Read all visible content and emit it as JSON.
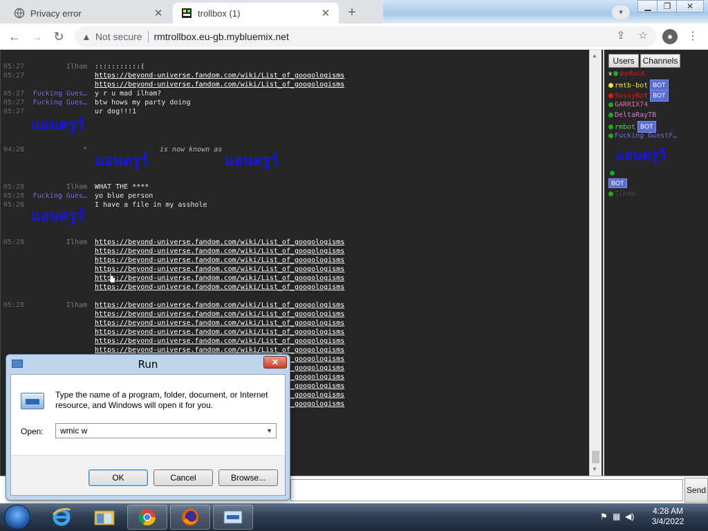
{
  "browser": {
    "tabs": [
      {
        "title": "Privacy error",
        "icon": "globe-icon"
      },
      {
        "title": "trollbox (1)",
        "icon": "trollbox-favicon"
      }
    ],
    "new_tab": "+",
    "close_glyph": "✕",
    "address": {
      "warning": "Not secure",
      "url": "rmtrollbox.eu-gb.mybluemix.net"
    }
  },
  "chat": {
    "lines": [
      {
        "time": "05:27",
        "nick": "Ilham",
        "text": ":::::::::::(",
        "link": false,
        "guest": false
      },
      {
        "time": "05:27",
        "nick": "",
        "text": "https://beyond-universe.fandom.com/wiki/List_of_googologisms",
        "link": true,
        "guest": false
      },
      {
        "time": "",
        "nick": "",
        "text": "https://beyond-universe.fandom.com/wiki/List_of_googologisms",
        "link": true,
        "guest": false
      },
      {
        "time": "05:27",
        "nick": "Fucking Gues…",
        "text": "y r u mad ilham?",
        "link": false,
        "guest": true
      },
      {
        "time": "05:27",
        "nick": "Fucking Gues…",
        "text": "btw hows my party doing",
        "link": false,
        "guest": true
      },
      {
        "time": "05:27",
        "nick": "",
        "text": "ur dog!!!1",
        "link": false,
        "guest": false
      }
    ],
    "rename_line": {
      "time": "04:28",
      "nick": "*",
      "text": "is now known as"
    },
    "thai_name": "แอนดรูว์",
    "lines2": [
      {
        "time": "05:28",
        "nick": "Ilham",
        "text": "WHAT THE ****",
        "guest": false
      },
      {
        "time": "05:28",
        "nick": "Fucking Gues…",
        "text": "yo blue person",
        "guest": true
      },
      {
        "time": "05:28",
        "nick": "",
        "text": "I have a file in my asshole",
        "guest": false
      }
    ],
    "block_a": {
      "time": "05:28",
      "nick": "Ilham",
      "count": 6
    },
    "block_b": {
      "time": "05:28",
      "nick": "Ilham",
      "count": 12
    },
    "link_text": "https://beyond-universe.fandom.com/wiki/List_of_googologisms"
  },
  "sidebar": {
    "buttons": [
      "Users",
      "Channels"
    ],
    "users": [
      {
        "name": "pyduck",
        "color": "#e01b1b",
        "dot": "#1fa81f",
        "bot": false,
        "crown": true
      },
      {
        "name": "rmtb-bot",
        "color": "#f3e03b",
        "dot": "#f3e03b",
        "bot": true,
        "crown": false
      },
      {
        "name": "SussyBot",
        "color": "#e01b1b",
        "dot": "#e01b1b",
        "bot": true,
        "crown": false
      },
      {
        "name": "GARRIX74",
        "color": "#e06aa8",
        "dot": "#1fa81f",
        "bot": false,
        "crown": false
      },
      {
        "name": "DeltaRayTB",
        "color": "#d07cd0",
        "dot": "#1fa81f",
        "bot": false,
        "crown": false
      },
      {
        "name": "rmbot",
        "color": "#59c859",
        "dot": "#1fa81f",
        "bot": true,
        "crown": false
      },
      {
        "name": "Fucking GuestF…",
        "color": "#6f6fd8",
        "dot": "#1fa81f",
        "bot": false,
        "crown": false
      }
    ],
    "bot_label": "BOT",
    "last_user": "Ilham"
  },
  "input": {
    "send_label": "Send"
  },
  "run_dialog": {
    "title": "Run",
    "description": "Type the name of a program, folder, document, or Internet resource, and Windows will open it for you.",
    "open_label": "Open:",
    "command": "wmic w",
    "ok": "OK",
    "cancel": "Cancel",
    "browse": "Browse..."
  },
  "taskbar": {
    "apps": [
      "internet-explorer-icon",
      "file-explorer-icon",
      "chrome-icon",
      "firefox-icon",
      "run-icon"
    ],
    "time": "4:28 AM",
    "date": "3/4/2022"
  }
}
